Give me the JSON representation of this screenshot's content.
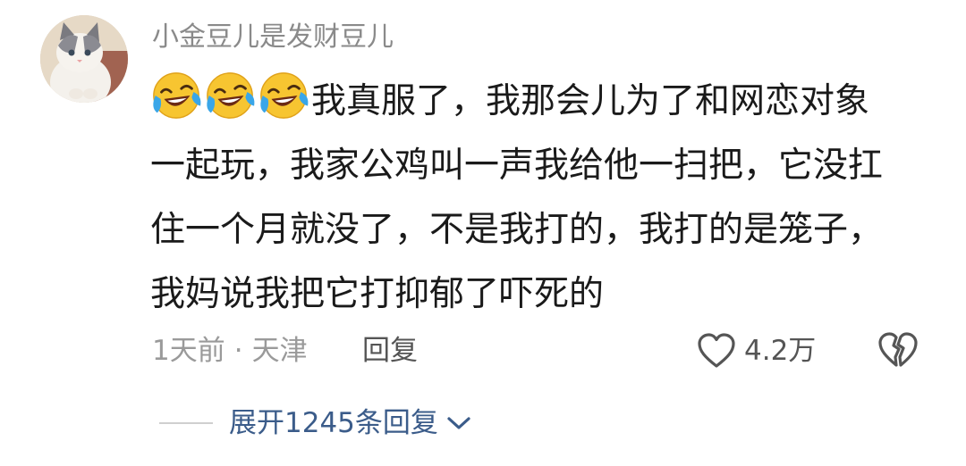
{
  "comment": {
    "username": "小金豆儿是发财豆儿",
    "avatar_icon": "cat-avatar",
    "emoji_icon": "laughing-tears-emoji",
    "emoji_count": 3,
    "lines": [
      "我真服了，我那会儿为了和网恋对象",
      "一起玩，我家公鸡叫一声我给他一扫把，它没扛",
      "住一个月就没了，不是我打的，我打的是笼子，",
      "我妈说我把它打抑郁了吓死的"
    ],
    "time": "1天前",
    "separator": "·",
    "location": "天津",
    "reply_label": "回复",
    "like_count": "4.2万",
    "like_icon": "heart-outline-icon",
    "dislike_icon": "broken-heart-icon",
    "expand_label": "展开1245条回复",
    "expand_icon": "chevron-down-icon",
    "colors": {
      "text": "#1a1a1a",
      "muted": "#8a8a8a",
      "link": "#3b5c8a"
    }
  }
}
